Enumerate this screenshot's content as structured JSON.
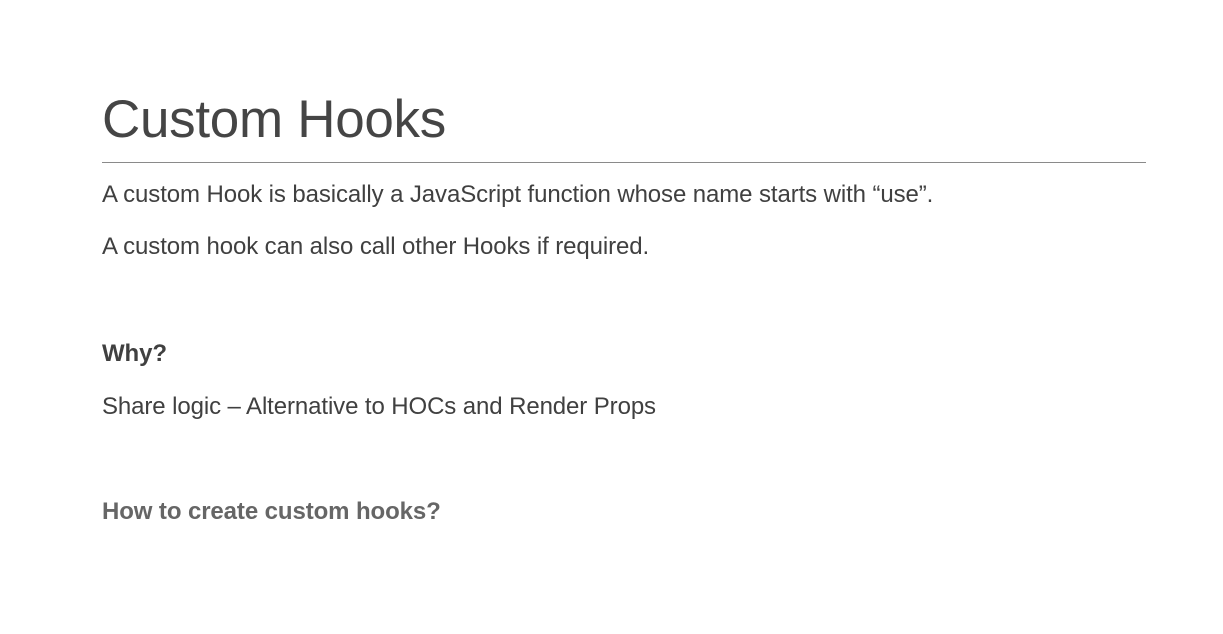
{
  "slide": {
    "title": "Custom Hooks",
    "lines": [
      "A custom Hook is basically a JavaScript function whose name starts with “use”.",
      "A custom hook can also call other Hooks if required."
    ],
    "why_heading": "Why?",
    "why_text": "Share logic – Alternative to HOCs and Render Props",
    "how_heading": "How to create custom hooks?"
  },
  "colors": {
    "text": "#404040",
    "subheading": "#666666",
    "rule": "#8a8a8a",
    "background": "#ffffff"
  }
}
